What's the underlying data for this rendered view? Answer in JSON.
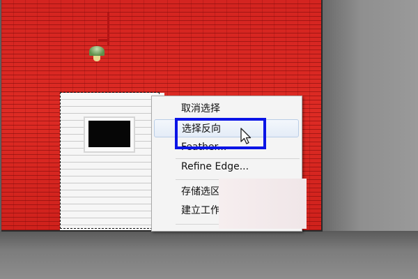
{
  "context_menu": {
    "items": [
      {
        "label": "取消选择",
        "state": "normal"
      },
      {
        "label": "选择反向",
        "state": "hover"
      },
      {
        "label": "Feather...",
        "state": "normal"
      },
      {
        "label": "Refine Edge...",
        "state": "normal"
      },
      {
        "label": "存储选区",
        "state": "normal"
      },
      {
        "label": "建立工作",
        "state": "normal"
      }
    ]
  },
  "annotation": {
    "highlight_color": "#0a14e6"
  },
  "colors": {
    "brick_wall": "#d8221f",
    "siding": "#f1f1f1",
    "workspace": "#5e5e5e",
    "menu_background": "#f4f4f4"
  },
  "icons": [
    "lamp",
    "arrow-cursor-icon"
  ]
}
